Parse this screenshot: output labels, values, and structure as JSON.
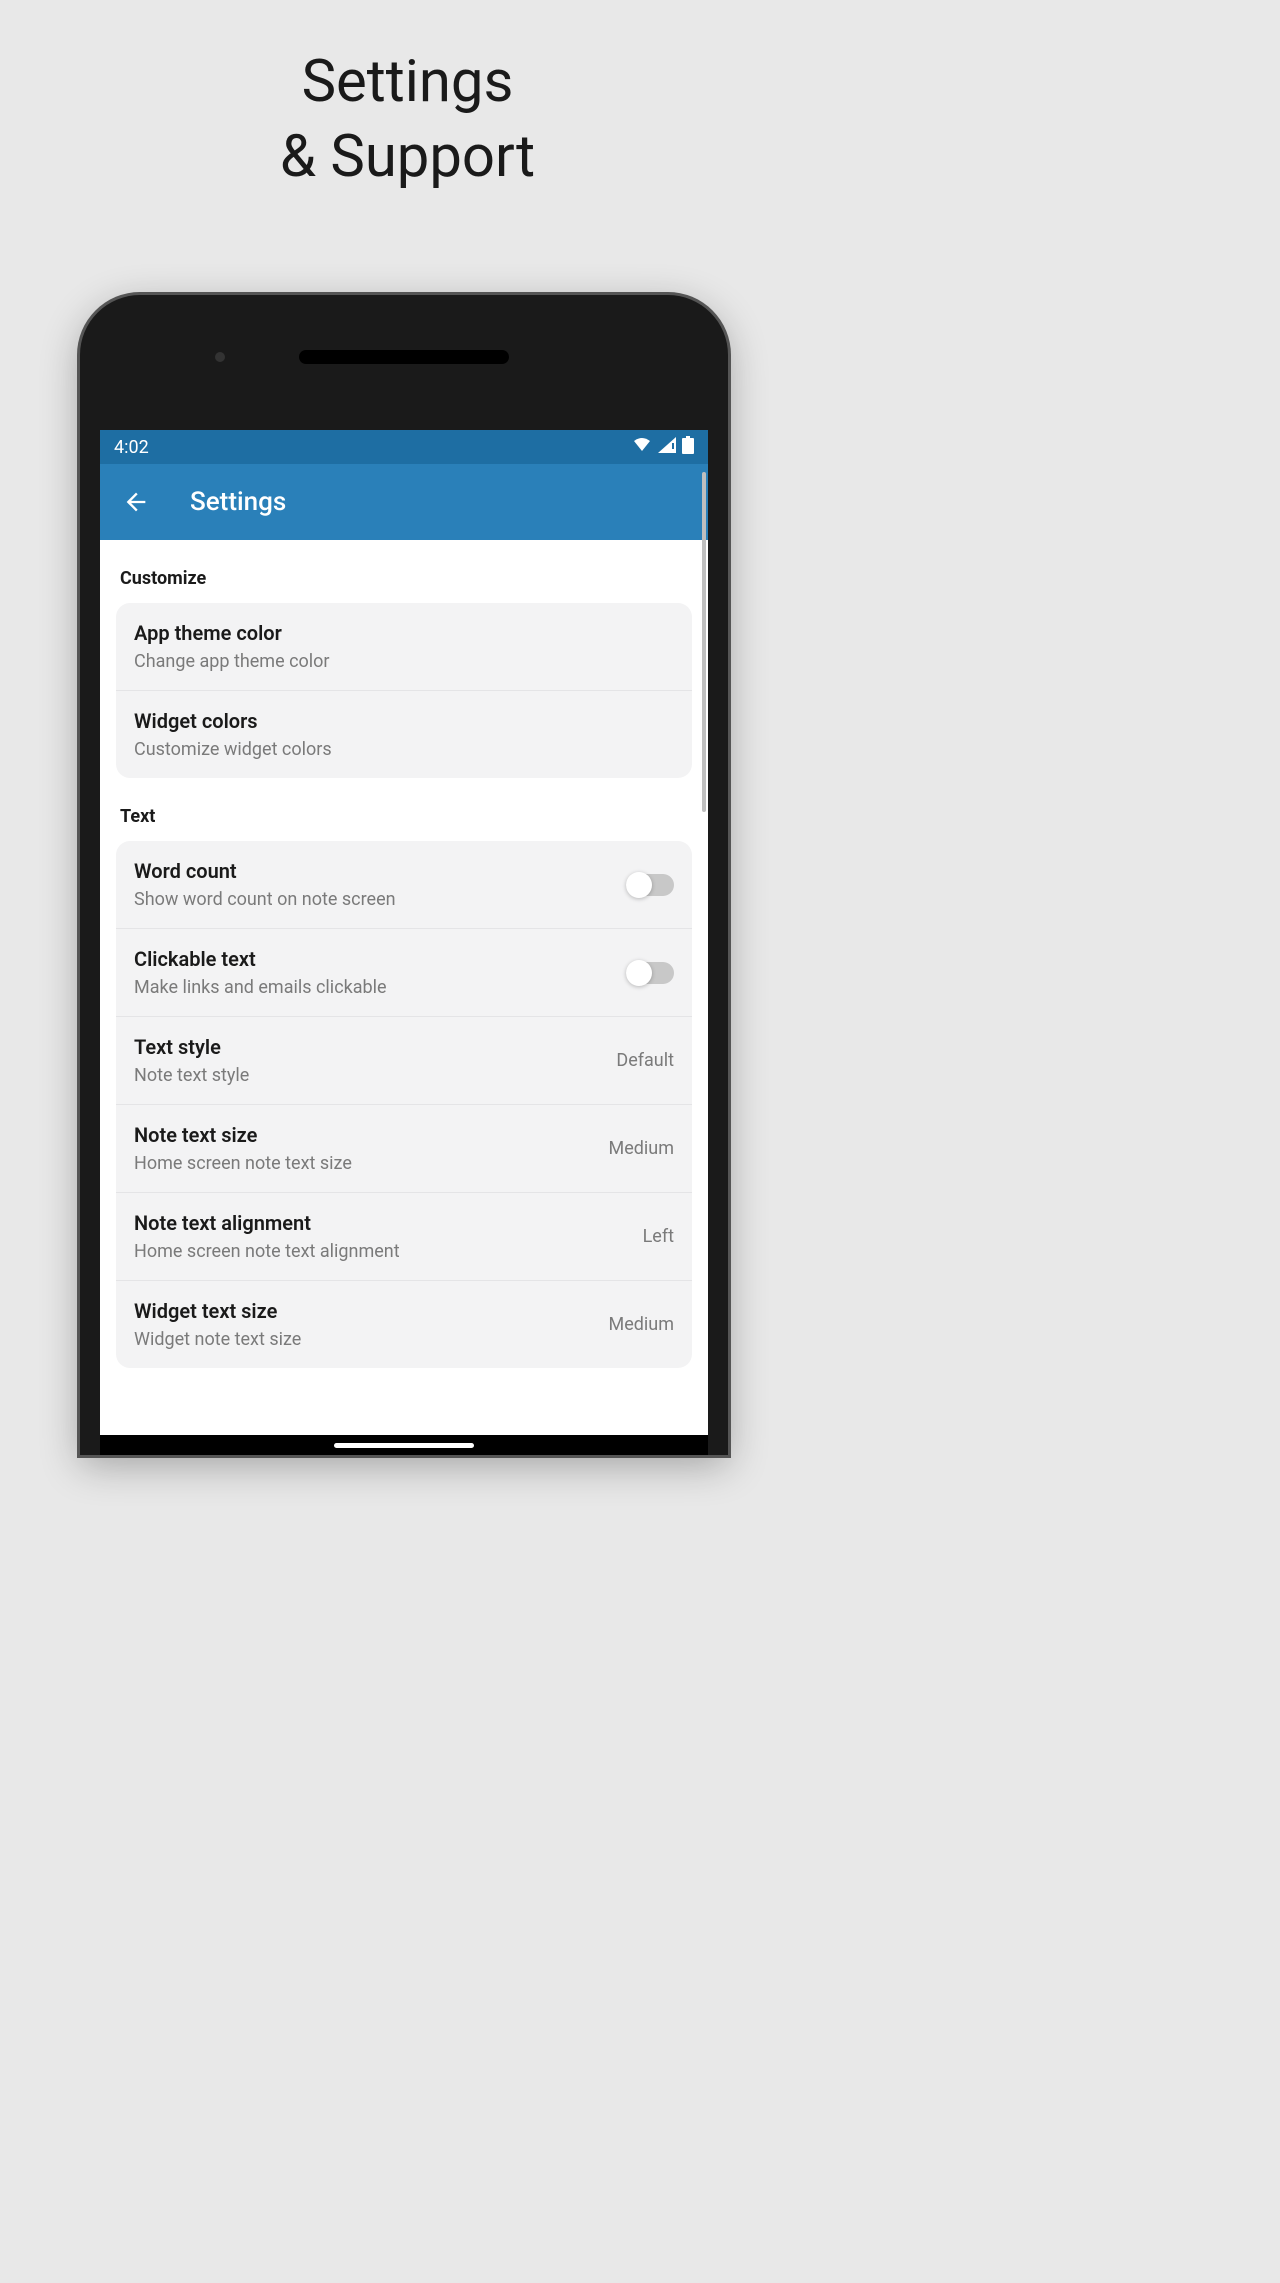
{
  "headline": {
    "line1": "Settings",
    "line2": "& Support"
  },
  "statusBar": {
    "time": "4:02"
  },
  "appBar": {
    "title": "Settings"
  },
  "sections": {
    "customize": {
      "header": "Customize",
      "items": [
        {
          "title": "App theme color",
          "subtitle": "Change app theme color"
        },
        {
          "title": "Widget colors",
          "subtitle": "Customize widget colors"
        }
      ]
    },
    "text": {
      "header": "Text",
      "items": [
        {
          "title": "Word count",
          "subtitle": "Show word count on note screen",
          "type": "toggle",
          "value": false
        },
        {
          "title": "Clickable text",
          "subtitle": "Make links and emails clickable",
          "type": "toggle",
          "value": false
        },
        {
          "title": "Text style",
          "subtitle": "Note text style",
          "type": "select",
          "value": "Default"
        },
        {
          "title": "Note text size",
          "subtitle": "Home screen note text size",
          "type": "select",
          "value": "Medium"
        },
        {
          "title": "Note text alignment",
          "subtitle": "Home screen note text alignment",
          "type": "select",
          "value": "Left"
        },
        {
          "title": "Widget text size",
          "subtitle": "Widget note text size",
          "type": "select",
          "value": "Medium"
        }
      ]
    }
  },
  "colors": {
    "statusBar": "#1e6ea3",
    "appBar": "#2a80b9",
    "cardBg": "#f3f3f4"
  }
}
